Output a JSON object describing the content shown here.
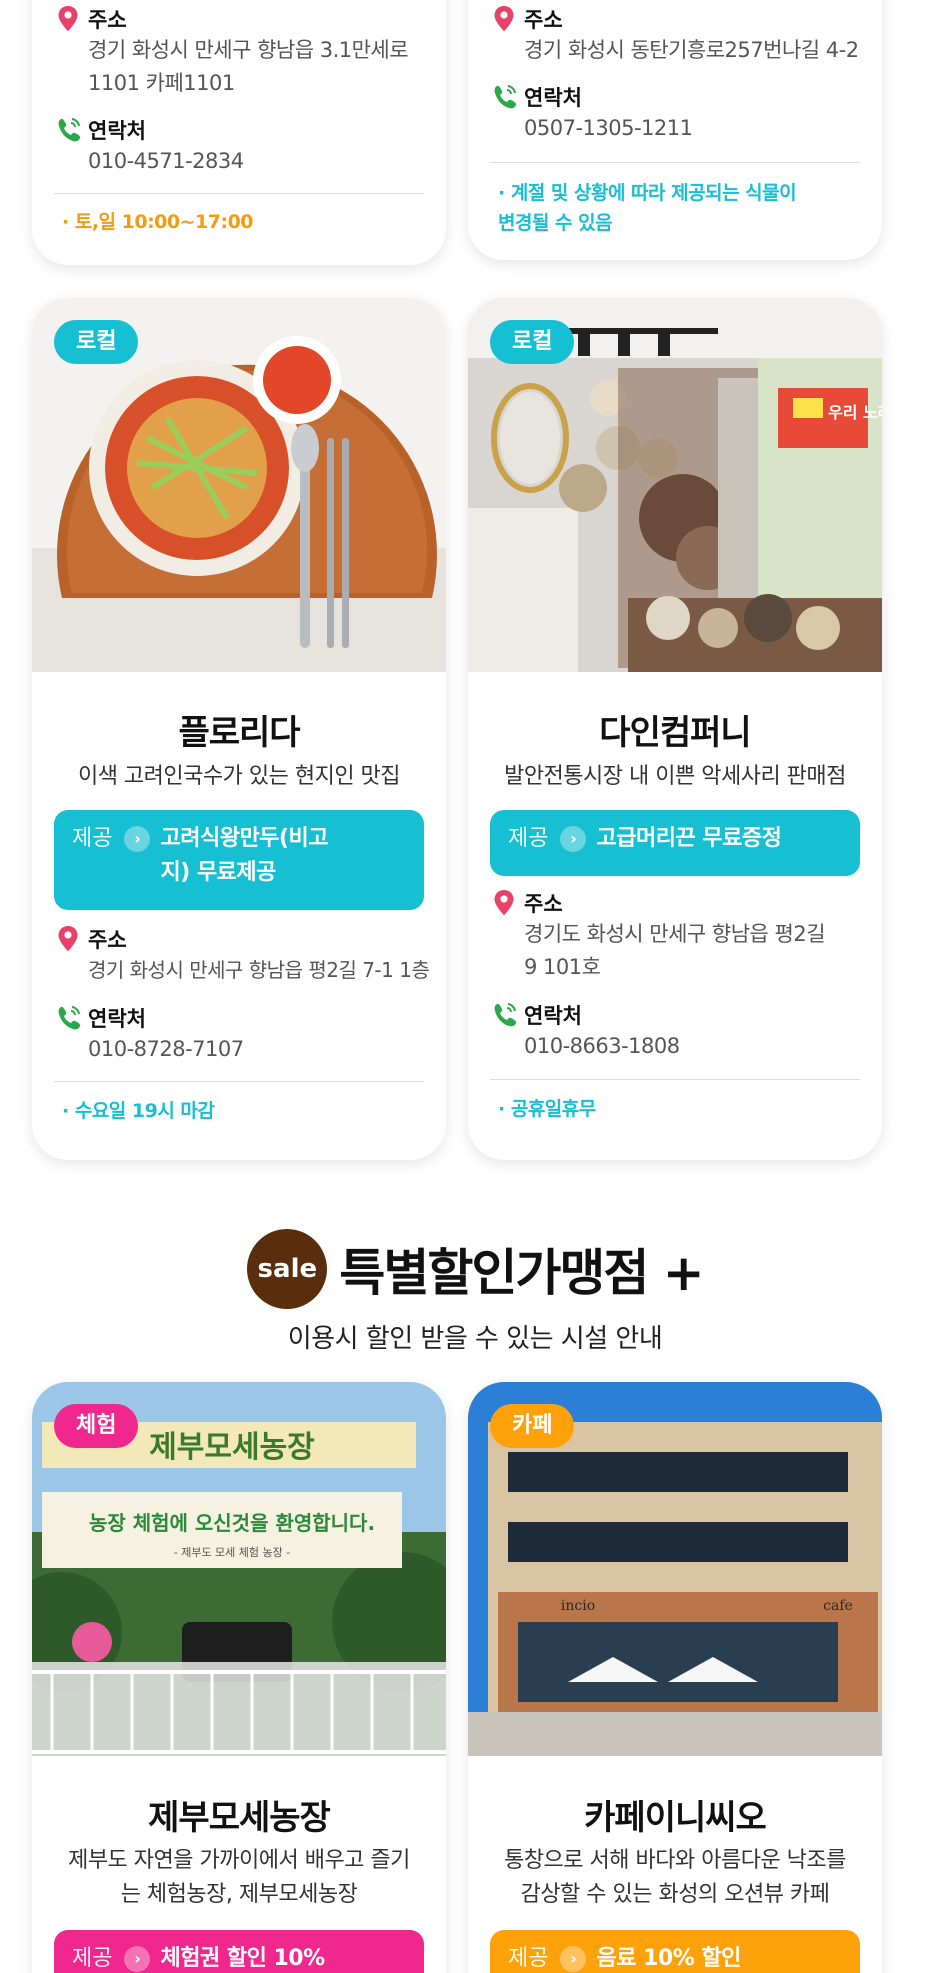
{
  "labels": {
    "address": "주소",
    "contact": "연락처",
    "offer": "제공"
  },
  "colors": {
    "teal": "#17bfd2",
    "pink": "#f0278d",
    "orange": "#ffa10a",
    "note_orange": "#f39c12",
    "sale_brown": "#5a2d0c",
    "pin_red": "#e8426b",
    "phone_green": "#2aa84a"
  },
  "icons": {
    "location": "map-pin-icon",
    "phone": "phone-icon",
    "arrow": "chevron-right-icon"
  },
  "top_cards": [
    {
      "address": "경기 화성시 만세구 향남읍 3.1만세로 1101 카페1101",
      "contact": "010-4571-2834",
      "note": "· 토,일 10:00~17:00"
    },
    {
      "address": "경기 화성시 동탄기흥로257번나길 4-2",
      "contact": "0507-1305-1211",
      "note": "· 계절 및 상황에 따라 제공되는 식물이 변경될 수 있음"
    }
  ],
  "local_cards": [
    {
      "badge": "로컬",
      "title": "플로리다",
      "description": "이색 고려인국수가 있는 현지인 맛집",
      "offer": "고려식왕만두(비고지) 무료제공",
      "address": "경기 화성시 만세구 향남읍 평2길 7-1 1층",
      "contact": "010-8728-7107",
      "note": "· 수요일 19시 마감"
    },
    {
      "badge": "로컬",
      "title": "다인컴퍼니",
      "description": "발안전통시장 내 이쁜 악세사리 판매점",
      "offer": "고급머리끈 무료증정",
      "address": "경기도 화성시 만세구 향남읍 평2길9 101호",
      "contact": "010-8663-1808",
      "note": "· 공휴일휴무"
    }
  ],
  "section": {
    "sale_badge": "sale",
    "title": "특별할인가맹점 +",
    "subtitle": "이용시 할인 받을 수 있는 시설 안내"
  },
  "sale_cards": [
    {
      "badge": "체험",
      "title": "제부모세농장",
      "description": "제부도 자연을 가까이에서 배우고 즐기는 체험농장, 제부모세농장",
      "offer": "체험권 할인 10%"
    },
    {
      "badge": "카페",
      "title": "카페이니씨오",
      "description": "통창으로 서해 바다와 아름다운 낙조를 감상할 수 있는 화성의 오션뷰 카페",
      "offer": "음료 10% 할인"
    }
  ],
  "photo_text": {
    "farm_sign": "제부모세농장",
    "farm_banner": "농장 체험에 오신것을 환영합니다.",
    "farm_banner_sub": "- 제부도 모세 체험 농장 -",
    "cafe_sign_left": "incio",
    "cafe_sign_right": "cafe",
    "shop_sign": "우리 노래"
  }
}
